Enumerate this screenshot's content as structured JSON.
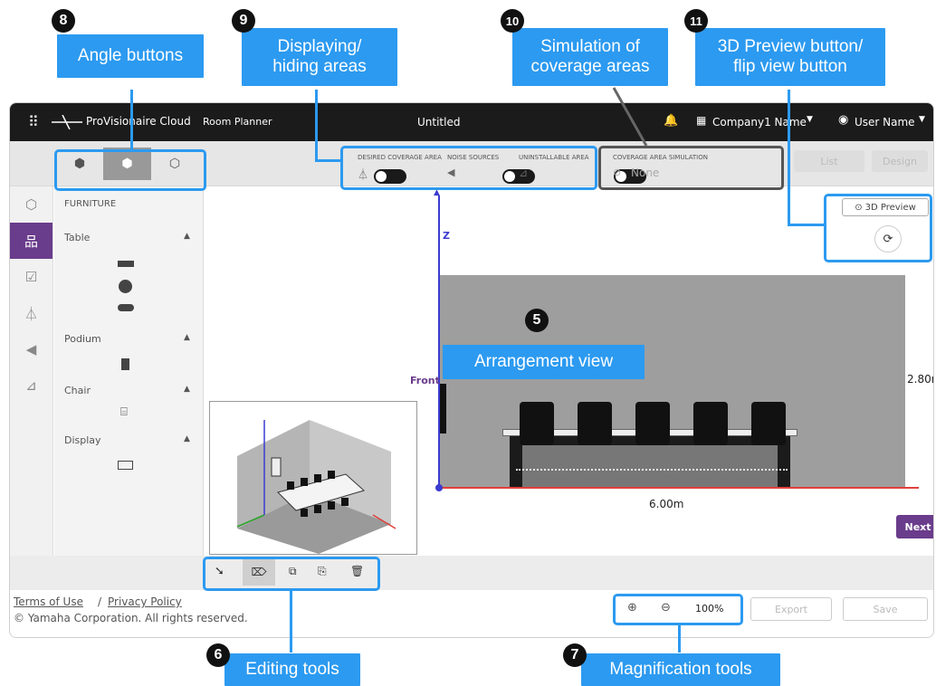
{
  "callouts": {
    "n8": "8",
    "n9": "9",
    "n10": "10",
    "n11": "11",
    "n5": "5",
    "n6": "6",
    "n7": "7",
    "angle": "Angle buttons",
    "display": "Displaying/\nhiding areas",
    "simulation": "Simulation of\ncoverage areas",
    "preview": "3D Preview button/\nflip view button",
    "arrangement": "Arrangement view",
    "editing": "Editing tools",
    "magnification": "Magnification tools"
  },
  "header": {
    "logo": "ProVisionaire Cloud",
    "app": "Room Planner",
    "title": "Untitled",
    "company": "Company1 Name",
    "user": "User Name"
  },
  "toolbar": {
    "desired": "DESIRED COVERAGE AREA",
    "noise": "NOISE SOURCES",
    "uninstallable": "UNINSTALLABLE AREA",
    "coverage_label": "COVERAGE AREA SIMULATION",
    "coverage_value": "None",
    "list": "List",
    "design": "Design"
  },
  "panel": {
    "title": "FURNITURE",
    "table": "Table",
    "podium": "Podium",
    "chair": "Chair",
    "display": "Display"
  },
  "view": {
    "preview_btn": "3D Preview",
    "z_label": "Z",
    "front": "Front",
    "height": "2.80m",
    "width": "6.00m",
    "next": "Next"
  },
  "footer": {
    "terms": "Terms of Use",
    "sep": "/",
    "privacy": "Privacy Policy",
    "copyright": "© Yamaha Corporation. All rights reserved.",
    "zoom": "100%",
    "export": "Export",
    "save": "Save"
  }
}
